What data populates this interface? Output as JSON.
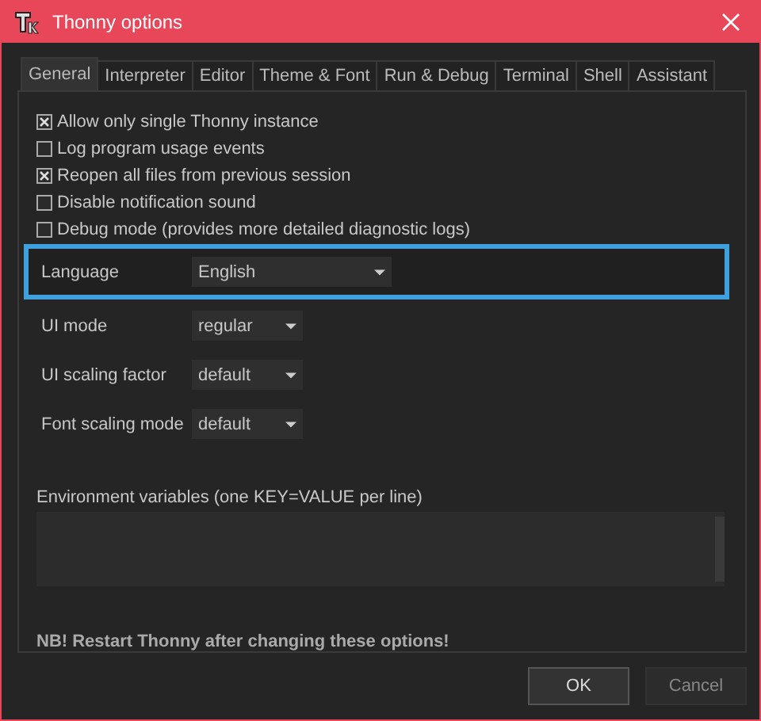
{
  "window": {
    "title": "Thonny options"
  },
  "tabs": [
    {
      "label": "General",
      "selected": true
    },
    {
      "label": "Interpreter",
      "selected": false
    },
    {
      "label": "Editor",
      "selected": false
    },
    {
      "label": "Theme & Font",
      "selected": false
    },
    {
      "label": "Run & Debug",
      "selected": false
    },
    {
      "label": "Terminal",
      "selected": false
    },
    {
      "label": "Shell",
      "selected": false
    },
    {
      "label": "Assistant",
      "selected": false
    }
  ],
  "options": [
    {
      "label": "Allow only single Thonny instance",
      "checked": true
    },
    {
      "label": "Log program usage events",
      "checked": false
    },
    {
      "label": "Reopen all files from previous session",
      "checked": true
    },
    {
      "label": "Disable notification sound",
      "checked": false
    },
    {
      "label": "Debug mode (provides more detailed diagnostic logs)",
      "checked": false
    }
  ],
  "settings": [
    {
      "label": "Language",
      "value": "English",
      "highlighted": true
    },
    {
      "label": "UI mode",
      "value": "regular",
      "highlighted": false
    },
    {
      "label": "UI scaling factor",
      "value": "default",
      "highlighted": false
    },
    {
      "label": "Font scaling mode",
      "value": "default",
      "highlighted": false
    }
  ],
  "environment": {
    "label": "Environment variables (one KEY=VALUE per line)"
  },
  "note": "NB! Restart Thonny after changing these options!",
  "buttons": [
    {
      "label": "OK",
      "kind": "default"
    },
    {
      "label": "Cancel",
      "kind": "normal"
    }
  ]
}
